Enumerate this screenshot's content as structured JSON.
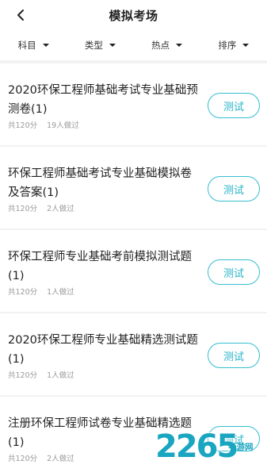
{
  "header": {
    "title": "模拟考场",
    "back_icon": "chevron-left-icon"
  },
  "filters": [
    {
      "label": "科目"
    },
    {
      "label": "类型"
    },
    {
      "label": "热点"
    },
    {
      "label": "排序"
    }
  ],
  "exams": [
    {
      "title": "2020环保工程师基础考试专业基础预测卷(1)",
      "score": "共120分",
      "takers": "19人做过",
      "button": "测试"
    },
    {
      "title": "环保工程师基础考试专业基础模拟卷及答案(1)",
      "score": "共120分",
      "takers": "2人做过",
      "button": "测试"
    },
    {
      "title": "环保工程师专业基础考前模拟测试题(1)",
      "score": "共120分",
      "takers": "1人做过",
      "button": "测试"
    },
    {
      "title": "2020环保工程师专业基础精选测试题(1)",
      "score": "共120分",
      "takers": "1人做过",
      "button": "测试"
    },
    {
      "title": "注册环保工程师试卷专业基础精选题(1)",
      "score": "共120分",
      "takers": "2人做过",
      "button": "测试"
    }
  ],
  "watermark": {
    "logo": "2265",
    "text": "手游网"
  },
  "colors": {
    "accent": "#35bdd0",
    "background": "#f2f2f2"
  }
}
